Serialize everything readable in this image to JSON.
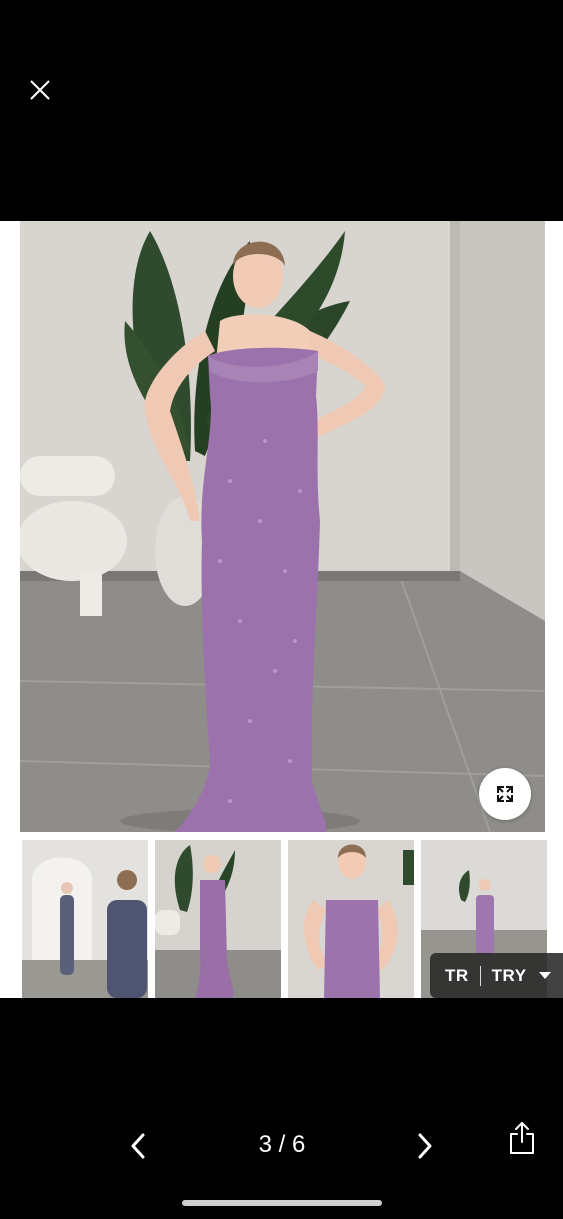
{
  "viewer": {
    "close_icon": "close-icon",
    "expand_icon": "expand-icon",
    "thumbnails": [
      {
        "name": "thumbnail-1",
        "dress_color": "#5a5f7a"
      },
      {
        "name": "thumbnail-2",
        "dress_color": "#9a6fa8"
      },
      {
        "name": "thumbnail-3",
        "dress_color": "#9c73ad"
      },
      {
        "name": "thumbnail-4",
        "dress_color": "#9d77ad"
      }
    ],
    "dress_color": "#9b72ab"
  },
  "currency": {
    "country": "TR",
    "code": "TRY",
    "icon": "caret-down-icon"
  },
  "pager": {
    "counter": "3 / 6",
    "prev_icon": "chevron-left-icon",
    "next_icon": "chevron-right-icon",
    "share_icon": "share-icon"
  }
}
